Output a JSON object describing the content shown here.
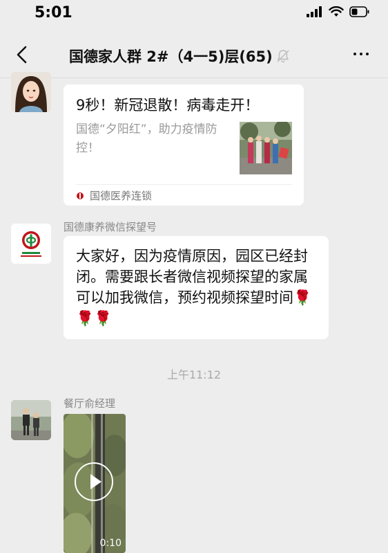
{
  "status_bar": {
    "time": "5:01"
  },
  "nav": {
    "title": "国德家人群 2#（4一5)层(65)"
  },
  "messages": {
    "link_card": {
      "title": "9秒！新冠退散！病毒走开！",
      "description": "国德“夕阳红”，助力疫情防控！",
      "source": "国德医养连锁"
    },
    "text_msg": {
      "sender": "国德康养微信探望号",
      "text": "大家好，因为疫情原因，园区已经封闭。需要跟长者微信视频探望的家属可以加我微信，预约视频探望时间🌹🌹🌹"
    },
    "timestamp": "上午11:12",
    "video_msg": {
      "sender": "餐厅俞经理",
      "duration": "0:10"
    }
  },
  "colors": {
    "background": "#ededed",
    "bubble": "#ffffff",
    "meta_text": "#888888",
    "brand_red": "#c0151a"
  }
}
